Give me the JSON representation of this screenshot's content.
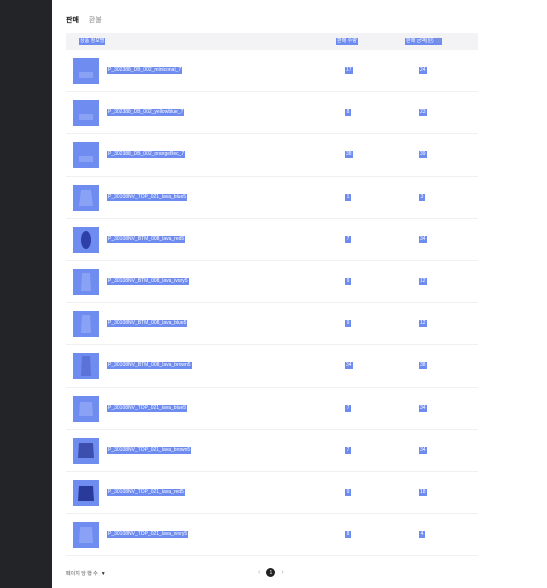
{
  "tabs": [
    {
      "label": "판매",
      "active": true
    },
    {
      "label": "환불",
      "active": false
    }
  ],
  "table": {
    "headers": {
      "product_name": "상품 정보명",
      "sales_count": "판매 수량",
      "view_count": "판매 금액(원)"
    },
    "rows": [
      {
        "name": "P_302388_DB_002_miniconal_7",
        "sales": "17",
        "views": "24"
      },
      {
        "name": "P_302388_DB_002_yellowblue_7",
        "sales": "8",
        "views": "23"
      },
      {
        "name": "P_302388_DB_002_orangeBec_7",
        "sales": "38",
        "views": "39"
      },
      {
        "name": "P_30108NV_TOP_021_lava_blue5",
        "sales": "1",
        "views": "3"
      },
      {
        "name": "P_30108NV_BTM_008_lava_red5",
        "sales": "7",
        "views": "34"
      },
      {
        "name": "P_30108NV_BTM_008_lava_ivory5",
        "sales": "9",
        "views": "12"
      },
      {
        "name": "P_30108NV_BTM_008_lava_blue5",
        "sales": "9",
        "views": "12"
      },
      {
        "name": "P_30108NV_BTM_008_lava_brown5",
        "sales": "34",
        "views": "38"
      },
      {
        "name": "P_30108NV_TOP_021_lava_blue5",
        "sales": "7",
        "views": "34"
      },
      {
        "name": "P_30108NV_TOP_021_lava_brown5",
        "sales": "7",
        "views": "34"
      },
      {
        "name": "P_30108NV_TOP_021_lava_red5",
        "sales": "9",
        "views": "18"
      },
      {
        "name": "P_30108NV_TOP_021_lava_ivory5",
        "sales": "8",
        "views": "4"
      }
    ]
  },
  "footer": {
    "per_page_label": "페이지 당 행 수",
    "current_page": "1",
    "prev_icon": "chevron-left-icon",
    "next_icon": "chevron-right-icon"
  },
  "colors": {
    "sidebar": "#232428",
    "highlight": "#6e8bf0",
    "header_bg": "#f3f3f5"
  }
}
